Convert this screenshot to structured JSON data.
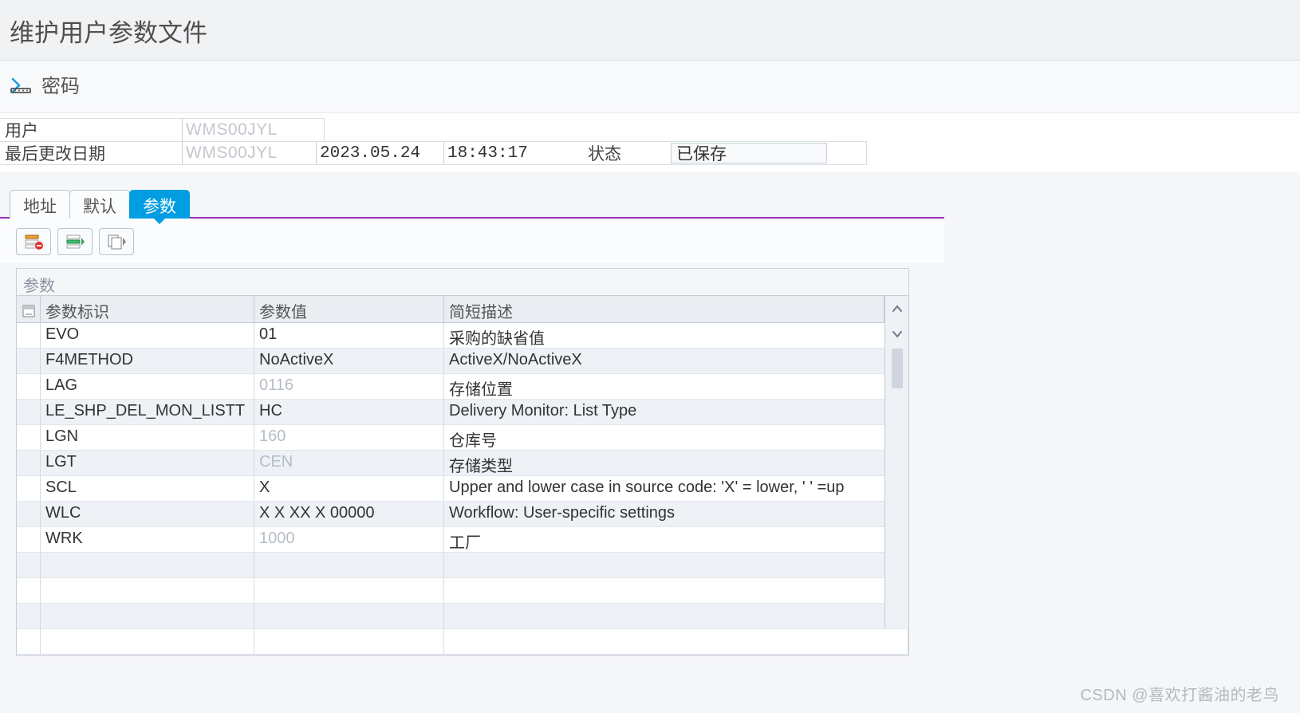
{
  "title": "维护用户参数文件",
  "password_label": "密码",
  "form": {
    "user_label": "用户",
    "user_value": "WMS00JYL",
    "last_changed_label": "最后更改日期",
    "last_changed_by": "WMS00JYL",
    "date": "2023.05.24",
    "time": "18:43:17",
    "status_label": "状态",
    "status_value": "已保存"
  },
  "tabs": [
    {
      "label": "地址",
      "active": false
    },
    {
      "label": "默认",
      "active": false
    },
    {
      "label": "参数",
      "active": true
    }
  ],
  "grid": {
    "section_title": "参数",
    "columns": {
      "id": "参数标识",
      "value": "参数值",
      "desc": "简短描述"
    },
    "rows": [
      {
        "id": "EVO",
        "value": "01",
        "value_dim": false,
        "desc": "采购的缺省值"
      },
      {
        "id": "F4METHOD",
        "value": "NoActiveX",
        "value_dim": false,
        "desc": "ActiveX/NoActiveX"
      },
      {
        "id": "LAG",
        "value": "0116",
        "value_dim": true,
        "desc": "存储位置"
      },
      {
        "id": "LE_SHP_DEL_MON_LISTT",
        "value": "HC",
        "value_dim": false,
        "desc": "Delivery Monitor: List Type"
      },
      {
        "id": "LGN",
        "value": "160",
        "value_dim": true,
        "desc": "仓库号"
      },
      {
        "id": "LGT",
        "value": "CEN",
        "value_dim": true,
        "desc": "存储类型"
      },
      {
        "id": "SCL",
        "value": "X",
        "value_dim": false,
        "desc": "Upper and lower case in source code: 'X' = lower, ' ' =up"
      },
      {
        "id": "WLC",
        "value": "X  X XX  X 00000",
        "value_dim": false,
        "desc": "Workflow: User-specific settings"
      },
      {
        "id": "WRK",
        "value": "1000",
        "value_dim": true,
        "desc": "工厂"
      },
      {
        "id": "",
        "value": "",
        "value_dim": false,
        "desc": ""
      },
      {
        "id": "",
        "value": "",
        "value_dim": false,
        "desc": ""
      },
      {
        "id": "",
        "value": "",
        "value_dim": false,
        "desc": ""
      },
      {
        "id": "",
        "value": "",
        "value_dim": false,
        "desc": ""
      }
    ]
  },
  "watermark": "CSDN @喜欢打酱油的老鸟"
}
